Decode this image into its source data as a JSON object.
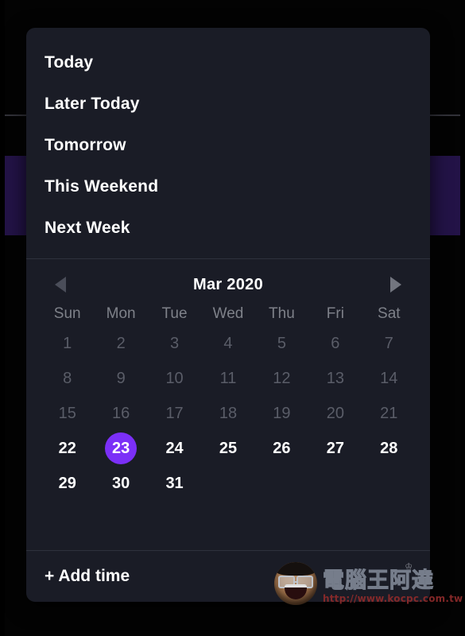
{
  "background": {
    "page_color": "#030303",
    "band_color": "#231347",
    "hairline_color": "#3a3a42"
  },
  "popup": {
    "background_color": "#1a1c26",
    "accent_color": "#7b2ff7"
  },
  "quick_menu": {
    "items": [
      {
        "label": "Today"
      },
      {
        "label": "Later Today"
      },
      {
        "label": "Tomorrow"
      },
      {
        "label": "This Weekend"
      },
      {
        "label": "Next Week"
      }
    ]
  },
  "calendar": {
    "title": "Mar 2020",
    "prev_icon": "triangle-left-icon",
    "next_icon": "triangle-right-icon",
    "weekdays": [
      "Sun",
      "Mon",
      "Tue",
      "Wed",
      "Thu",
      "Fri",
      "Sat"
    ],
    "selected_day": 23,
    "weeks": [
      [
        {
          "day": "1",
          "state": "disabled"
        },
        {
          "day": "2",
          "state": "disabled"
        },
        {
          "day": "3",
          "state": "disabled"
        },
        {
          "day": "4",
          "state": "disabled"
        },
        {
          "day": "5",
          "state": "disabled"
        },
        {
          "day": "6",
          "state": "disabled"
        },
        {
          "day": "7",
          "state": "disabled"
        }
      ],
      [
        {
          "day": "8",
          "state": "disabled"
        },
        {
          "day": "9",
          "state": "disabled"
        },
        {
          "day": "10",
          "state": "disabled"
        },
        {
          "day": "11",
          "state": "disabled"
        },
        {
          "day": "12",
          "state": "disabled"
        },
        {
          "day": "13",
          "state": "disabled"
        },
        {
          "day": "14",
          "state": "disabled"
        }
      ],
      [
        {
          "day": "15",
          "state": "disabled"
        },
        {
          "day": "16",
          "state": "disabled"
        },
        {
          "day": "17",
          "state": "disabled"
        },
        {
          "day": "18",
          "state": "disabled"
        },
        {
          "day": "19",
          "state": "disabled"
        },
        {
          "day": "20",
          "state": "disabled"
        },
        {
          "day": "21",
          "state": "disabled"
        }
      ],
      [
        {
          "day": "22",
          "state": "enabled"
        },
        {
          "day": "23",
          "state": "selected"
        },
        {
          "day": "24",
          "state": "enabled"
        },
        {
          "day": "25",
          "state": "enabled"
        },
        {
          "day": "26",
          "state": "enabled"
        },
        {
          "day": "27",
          "state": "enabled"
        },
        {
          "day": "28",
          "state": "enabled"
        }
      ],
      [
        {
          "day": "29",
          "state": "enabled"
        },
        {
          "day": "30",
          "state": "enabled"
        },
        {
          "day": "31",
          "state": "enabled"
        },
        {
          "day": "",
          "state": "empty"
        },
        {
          "day": "",
          "state": "empty"
        },
        {
          "day": "",
          "state": "empty"
        },
        {
          "day": "",
          "state": "empty"
        }
      ]
    ]
  },
  "footer": {
    "add_time_label": "+ Add time"
  },
  "watermark": {
    "crown_glyph": "♔",
    "site_name": "電腦王阿達",
    "url": "http://www.kocpc.com.tw"
  }
}
